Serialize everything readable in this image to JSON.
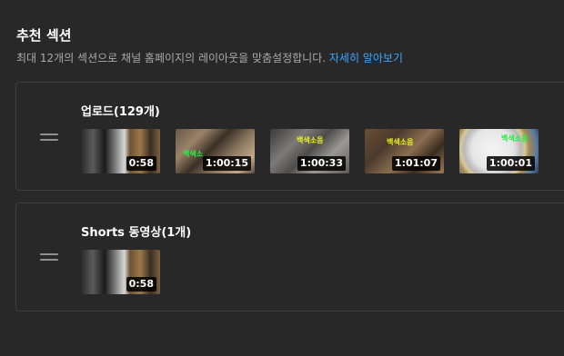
{
  "header": {
    "title": "추천 섹션",
    "description": "최대 12개의 섹션으로 채널 홈페이지의 레이아웃을 맞춤설정합니다. ",
    "learn_more": "자세히 알아보기"
  },
  "sections": [
    {
      "title": "업로드(129개)",
      "videos": [
        {
          "duration": "0:58",
          "overlay": ""
        },
        {
          "duration": "1:00:15",
          "overlay": "백색소"
        },
        {
          "duration": "1:00:33",
          "overlay": "백색소음"
        },
        {
          "duration": "1:01:07",
          "overlay": "백색소음"
        },
        {
          "duration": "1:00:01",
          "overlay": "백색소음"
        }
      ]
    },
    {
      "title": "Shorts 동영상(1개)",
      "videos": [
        {
          "duration": "0:58",
          "overlay": ""
        }
      ]
    }
  ],
  "colors": {
    "background": "#282828",
    "link": "#3ea6ff",
    "border": "#3e3e3e"
  }
}
